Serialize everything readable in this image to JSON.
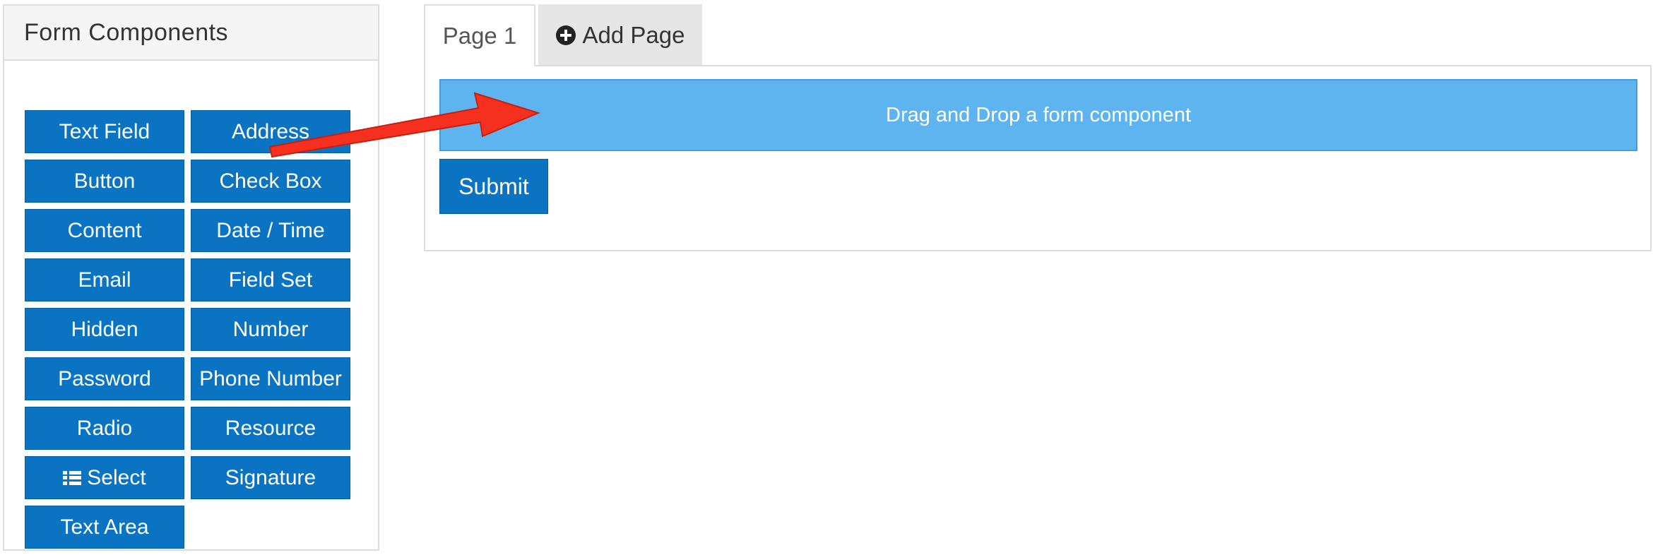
{
  "panel": {
    "title": "Form Components",
    "components": [
      {
        "label": "Text Field",
        "icon": ""
      },
      {
        "label": "Address",
        "icon": ""
      },
      {
        "label": "Button",
        "icon": ""
      },
      {
        "label": "Check Box",
        "icon": ""
      },
      {
        "label": "Content",
        "icon": ""
      },
      {
        "label": "Date / Time",
        "icon": ""
      },
      {
        "label": "Email",
        "icon": ""
      },
      {
        "label": "Field Set",
        "icon": ""
      },
      {
        "label": "Hidden",
        "icon": ""
      },
      {
        "label": "Number",
        "icon": ""
      },
      {
        "label": "Password",
        "icon": ""
      },
      {
        "label": "Phone Number",
        "icon": ""
      },
      {
        "label": "Radio",
        "icon": ""
      },
      {
        "label": "Resource",
        "icon": ""
      },
      {
        "label": "Select",
        "icon": "list-icon"
      },
      {
        "label": "Signature",
        "icon": ""
      },
      {
        "label": "Text Area",
        "icon": ""
      }
    ]
  },
  "tabs": {
    "page1": "Page 1",
    "add_page": "Add Page"
  },
  "form": {
    "dropzone_text": "Drag and Drop a form component",
    "submit_label": "Submit"
  },
  "colors": {
    "button_blue": "#0a74c3",
    "dropzone_blue": "#5db4ef",
    "arrow_red": "#f5301e"
  }
}
